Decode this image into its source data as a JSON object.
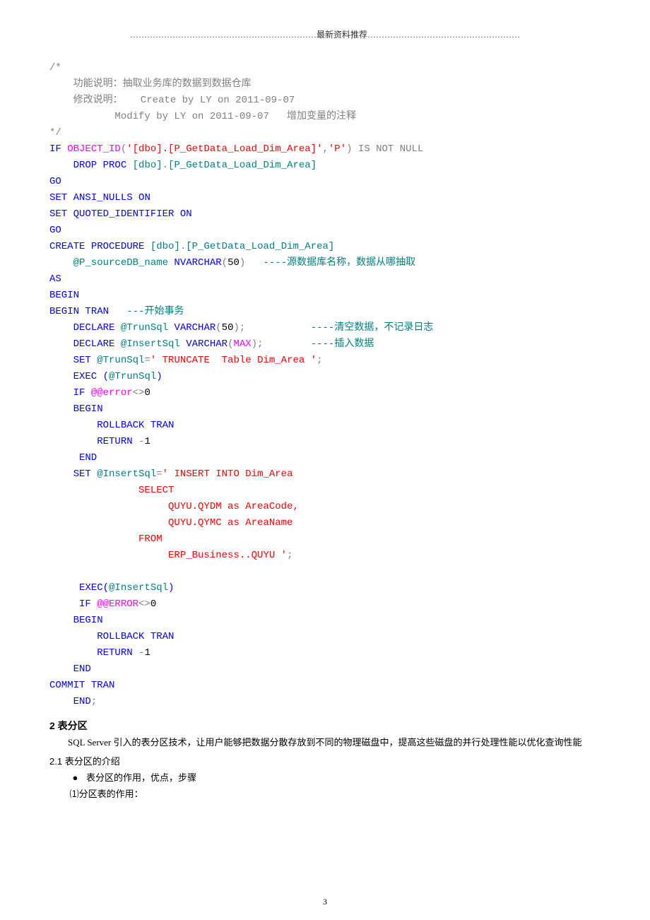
{
  "header": "…………………………………………………………最新资料推荐………………………………………………",
  "code": {
    "l1": "/*",
    "l2": "    功能说明：抽取业务库的数据到数据仓库",
    "l3": "    修改说明：   Create by LY on 2011-09-07",
    "l4": "           Modify by LY on 2011-09-07   增加变量的注释",
    "l5": "*/",
    "l6a": "IF",
    "l6b": " OBJECT_ID",
    "l6c": "(",
    "l6d": "'[dbo].[P_GetData_Load_Dim_Area]'",
    "l6e": ",",
    "l6f": "'P'",
    "l6g": ")",
    "l6h": " IS NOT NULL",
    "l7a": "    DROP",
    "l7b": " PROC",
    "l7c": " [dbo]",
    "l7d": ".",
    "l7e": "[P_GetData_Load_Dim_Area]",
    "l8": "GO",
    "l9a": "SET",
    "l9b": " ANSI_NULLS",
    "l9c": " ON",
    "l10a": "SET",
    "l10b": " QUOTED_IDENTIFIER",
    "l10c": " ON",
    "l11": "GO",
    "l12a": "CREATE",
    "l12b": " PROCEDURE",
    "l12c": " [dbo]",
    "l12d": ".",
    "l12e": "[P_GetData_Load_Dim_Area]",
    "l13a": "    @P_sourceDB_name",
    "l13b": " NVARCHAR",
    "l13c": "(",
    "l13d": "50",
    "l13e": ")",
    "l13f": "   ----源数据库名称，数据从哪抽取",
    "l14": "AS",
    "l15": "BEGIN",
    "l16a": "BEGIN",
    "l16b": " TRAN",
    "l16c": "   ---开始事务",
    "l17a": "    DECLARE",
    "l17b": " @TrunSql",
    "l17c": " VARCHAR",
    "l17d": "(",
    "l17e": "50",
    "l17f": ");",
    "l17g": "           ----清空数据，不记录日志",
    "l18a": "    DECLARE",
    "l18b": " @InsertSql",
    "l18c": " VARCHAR",
    "l18d": "(",
    "l18e": "MAX",
    "l18f": ");",
    "l18g": "        ----插入数据",
    "l19a": "    SET",
    "l19b": " @TrunSql",
    "l19c": "=",
    "l19d": "' TRUNCATE  Table Dim_Area '",
    "l19e": ";",
    "l20a": "    EXEC",
    "l20b": " (",
    "l20c": "@TrunSql",
    "l20d": ")",
    "l21a": "    IF",
    "l21b": " @@error",
    "l21c": "<>",
    "l21d": "0",
    "l22": "    BEGIN",
    "l23a": "        ROLLBACK",
    "l23b": " TRAN",
    "l24a": "        RETURN",
    "l24b": " -",
    "l24c": "1",
    "l25": "     END",
    "l26a": "    SET",
    "l26b": " @InsertSql",
    "l26c": "=",
    "l26d": "' INSERT INTO Dim_Area",
    "l27": "               SELECT",
    "l28": "                    QUYU.QYDM as AreaCode,",
    "l29": "                    QUYU.QYMC as AreaName",
    "l30": "               FROM",
    "l31a": "                    ERP_Business..QUYU '",
    "l31b": ";",
    "l32": " ",
    "l33a": "     EXEC",
    "l33b": "(",
    "l33c": "@InsertSql",
    "l33d": ")",
    "l34a": "     IF",
    "l34b": " @@ERROR",
    "l34c": "<>",
    "l34d": "0",
    "l35": "    BEGIN",
    "l36a": "        ROLLBACK",
    "l36b": " TRAN",
    "l37a": "        RETURN",
    "l37b": " -",
    "l37c": "1",
    "l38": "    END",
    "l39a": "COMMIT",
    "l39b": " TRAN",
    "l40a": "    END",
    "l40b": ";"
  },
  "sections": {
    "s2_num": "2",
    "s2_title": "   表分区",
    "s2_para": "SQL  Server 引入的表分区技术，让用户能够把数据分散存放到不同的物理磁盘中，提高这些磁盘的并行处理性能以优化查询性能",
    "s21_num": "2.1",
    "s21_title": "      表分区的介绍",
    "bullet1": "表分区的作用，优点，步骤",
    "item1": "⑴分区表的作用："
  },
  "page_num": "3"
}
